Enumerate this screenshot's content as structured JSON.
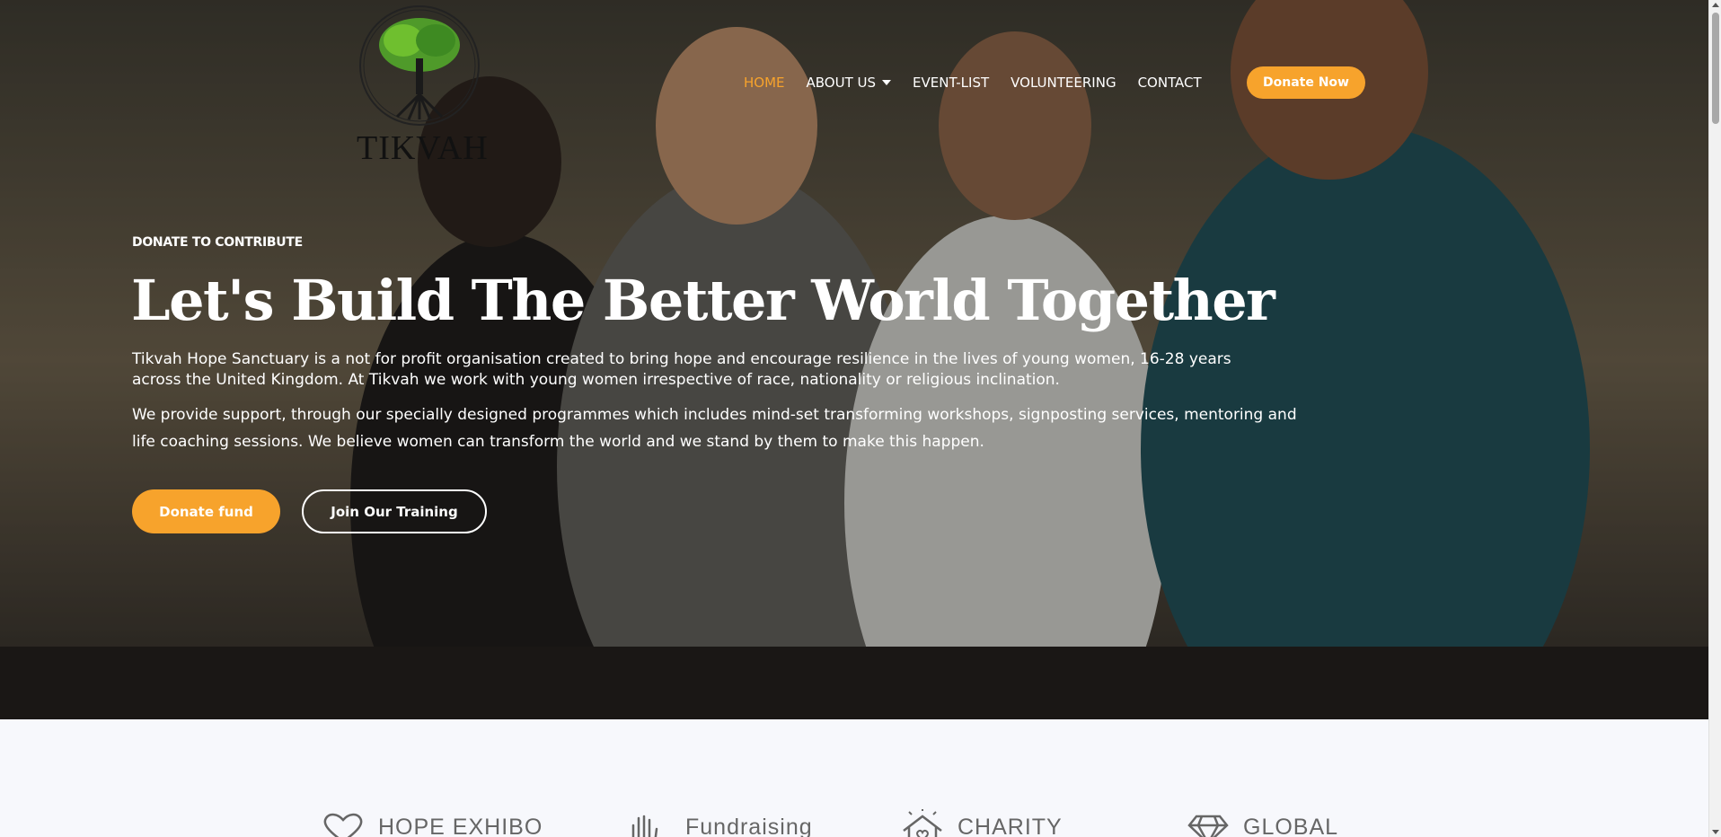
{
  "brand": {
    "logo_text": "TIKVAH"
  },
  "nav": {
    "items": [
      {
        "label": "HOME",
        "active": true
      },
      {
        "label": "ABOUT US",
        "has_dropdown": true
      },
      {
        "label": "EVENT-LIST"
      },
      {
        "label": "VOLUNTEERING"
      },
      {
        "label": "CONTACT"
      }
    ],
    "cta_label": "Donate Now"
  },
  "hero": {
    "eyebrow": "DONATE TO CONTRIBUTE",
    "headline": "Let's Build The Better World Together",
    "paragraph1": "Tikvah Hope Sanctuary is a not for profit organisation created to bring hope and encourage resilience in the lives of young women, 16-28 years across the United Kingdom. At Tikvah we work with young women irrespective of race, nationality or religious inclination.",
    "paragraph2": "We provide support, through our specially designed programmes which includes mind-set transforming workshops, signposting services, mentoring and life coaching sessions. We believe women can transform the world and we stand by them to make this happen.",
    "primary_button": "Donate fund",
    "secondary_button": "Join Our Training"
  },
  "features": [
    {
      "label": "HOPE EXHIBO",
      "icon": "heart-icon"
    },
    {
      "label": "Fundraising",
      "icon": "hands-icon"
    },
    {
      "label": "CHARITY",
      "icon": "charity-home-icon"
    },
    {
      "label": "GLOBAL",
      "icon": "diamond-icon"
    }
  ],
  "colors": {
    "accent": "#f7a32c",
    "text_light": "#ffffff",
    "section_bg": "#f7f8fc"
  }
}
